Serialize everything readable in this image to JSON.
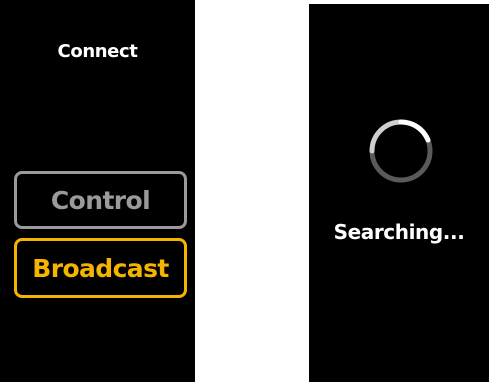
{
  "left_screen": {
    "title": "Connect",
    "options": [
      {
        "label": "Control",
        "state": "unselected",
        "color": "#9a9a9a"
      },
      {
        "label": "Broadcast",
        "state": "selected",
        "color": "#f5b400"
      }
    ]
  },
  "right_screen": {
    "spinner_icon": "loading-spinner-icon",
    "status_text": "Searching..."
  },
  "colors": {
    "background": "#000000",
    "accent": "#f5b400",
    "inactive": "#9a9a9a",
    "text": "#ffffff"
  }
}
